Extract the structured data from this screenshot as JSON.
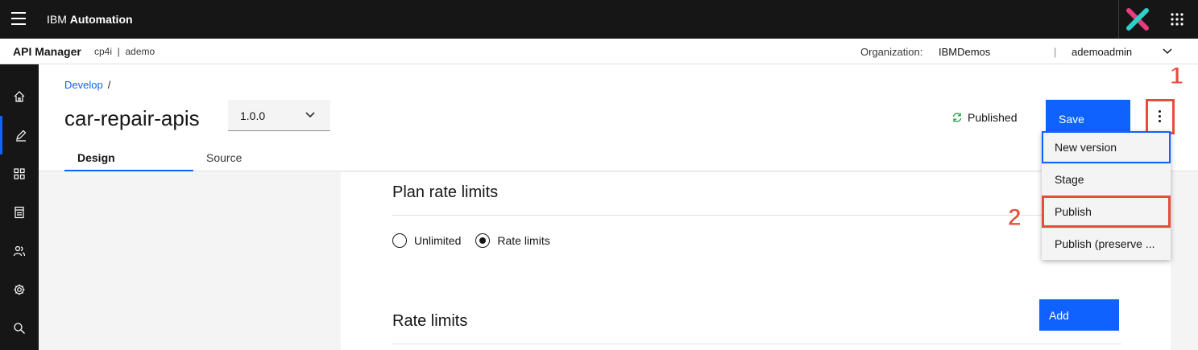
{
  "topbar": {
    "brand_prefix": "IBM",
    "brand_name": "Automation"
  },
  "subbar": {
    "app_name": "API Manager",
    "context": "cp4i  |  ademo",
    "org_label": "Organization:",
    "org_value": "IBMDemos",
    "separator": "|",
    "user": "ademoadmin"
  },
  "leftnav": [
    "home-icon",
    "edit-icon",
    "apps-icon",
    "catalog-icon",
    "members-icon",
    "settings-icon",
    "search-icon"
  ],
  "header": {
    "breadcrumb_link": "Develop",
    "breadcrumb_sep": "/",
    "title": "car-repair-apis",
    "version": "1.0.0",
    "status": "Published",
    "save_label": "Save",
    "tabs": [
      {
        "label": "Design"
      },
      {
        "label": "Source"
      }
    ]
  },
  "content": {
    "plan_rate_limits_title": "Plan rate limits",
    "radio_unlimited": "Unlimited",
    "radio_rate_limits": "Rate limits",
    "selected": "Rate limits",
    "rate_limits_title": "Rate limits",
    "add_label": "Add"
  },
  "menu": {
    "items": [
      {
        "label": "New version"
      },
      {
        "label": "Stage"
      },
      {
        "label": "Publish"
      },
      {
        "label": "Publish (preserve ..."
      }
    ]
  },
  "annotations": {
    "one": "1",
    "two": "2"
  },
  "colors": {
    "primary": "#0f62fe",
    "annotation": "#e74c3c",
    "shell": "#161616",
    "published": "#24a148"
  }
}
